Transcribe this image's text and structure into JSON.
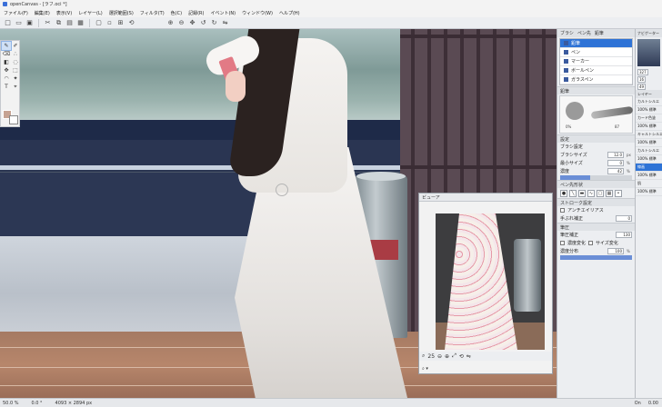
{
  "window": {
    "title": "openCanvas - [ラフ.oci *]"
  },
  "menu": [
    "ファイル(F)",
    "編集(E)",
    "表示(V)",
    "レイヤー(L)",
    "選択範囲(S)",
    "フィルタ(T)",
    "色(C)",
    "記録(R)",
    "イベント(N)",
    "ウィンドウ(W)",
    "ヘルプ(H)"
  ],
  "right_panel": {
    "tabs": [
      "ブラシ",
      "ペン先",
      "鉛筆"
    ],
    "brushes": [
      {
        "label": "鉛筆",
        "selected": true
      },
      {
        "label": "ペン",
        "selected": false
      },
      {
        "label": "マーカー",
        "selected": false
      },
      {
        "label": "ボールペン",
        "selected": false
      },
      {
        "label": "ガラスペン",
        "selected": false
      }
    ],
    "tip_section": "鉛筆",
    "stroke_caption": "0%",
    "stroke_value": "87",
    "settings_section": "設定",
    "brush_settings": "ブラシ設定",
    "size_label": "ブラシサイズ",
    "size_value": "12.0",
    "size_unit": "px",
    "min_size_label": "最小サイズ",
    "min_size_value": "0",
    "min_size_unit": "%",
    "density_label": "濃度",
    "density_value": "42",
    "density_unit": "%",
    "density_fraction": 0.42,
    "tip_shape": "ペン先形状",
    "stroke_settings": "ストローク設定",
    "antialias": "アンチエイリアス",
    "hand_correction_label": "手ぶれ補正",
    "hand_correction_value": "0",
    "pressure_section": "筆圧",
    "pressure_curve_label": "筆圧補正",
    "pressure_curve_value": "130",
    "density_change": "濃度変化",
    "size_change": "サイズ変化",
    "density_dist_label": "濃度分布",
    "density_dist_value": "100",
    "density_dist_unit": "%",
    "density_dist_fraction": 1.0
  },
  "color_panel": {
    "head": "ナビゲーター",
    "values": [
      "327",
      "16",
      "49"
    ],
    "layer_head": "レイヤー",
    "layers": [
      {
        "label": "カルトシルエ",
        "selected": false
      },
      {
        "label": "100% 標準",
        "selected": false
      },
      {
        "label": "カード色塗",
        "selected": false
      },
      {
        "label": "100% 標準",
        "selected": false
      },
      {
        "label": "キャルトシルエ",
        "selected": false
      },
      {
        "label": "100% 標準",
        "selected": false
      },
      {
        "label": "カルトシルエ",
        "selected": false
      },
      {
        "label": "100% 標準",
        "selected": false
      },
      {
        "label": "線画",
        "selected": true
      },
      {
        "label": "100% 標準",
        "selected": false
      },
      {
        "label": "肌",
        "selected": false
      },
      {
        "label": "100% 標準",
        "selected": false
      }
    ]
  },
  "preview": {
    "title": "ビューア",
    "zoom": "25"
  },
  "status": {
    "zoom": "50.0 %",
    "angle": "0.0 °",
    "size": "4093 × 2894 px",
    "right1": "On",
    "right2": "0.00"
  }
}
